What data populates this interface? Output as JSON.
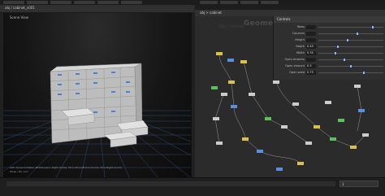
{
  "viewport": {
    "title": "Scene View",
    "path": "obj / cabinet_v001",
    "status_lines": [
      "Left mouse tumbles. Middle pans. Right dollies. Ctrl+Alt+Left box-zooms. Ctrl+Right zooms.",
      "Persp / No cam"
    ]
  },
  "network": {
    "path": "obj > cabinet",
    "context_label": "Geometry",
    "object_label": "obj / cabinet"
  },
  "params": {
    "header": "Controls",
    "rows": [
      {
        "label": "Rows",
        "value": "",
        "fill": 0.85
      },
      {
        "label": "Columns",
        "value": "",
        "fill": 0.6
      },
      {
        "label": "Height",
        "value": "",
        "fill": 0.45
      },
      {
        "label": "Depth",
        "value": "0.45",
        "fill": 0.3
      },
      {
        "label": "Width",
        "value": "0.35",
        "fill": 0.25
      },
      {
        "label": "Open drawers",
        "value": "",
        "fill": 0.4
      },
      {
        "label": "Open amount",
        "value": "0.5",
        "fill": 0.5
      },
      {
        "label": "Open seed",
        "value": "0.75",
        "fill": 0.7
      }
    ]
  },
  "timeline": {
    "frame": "1"
  },
  "colors": {
    "grid": "#2f5a8f",
    "cabinet": "#c9c9c9",
    "label_tag": "#4a7fd6",
    "node_yellow": "#d8c24a",
    "node_green": "#5fbf5f",
    "node_blue": "#5a8fe0",
    "wire": "#9a9a9a"
  }
}
